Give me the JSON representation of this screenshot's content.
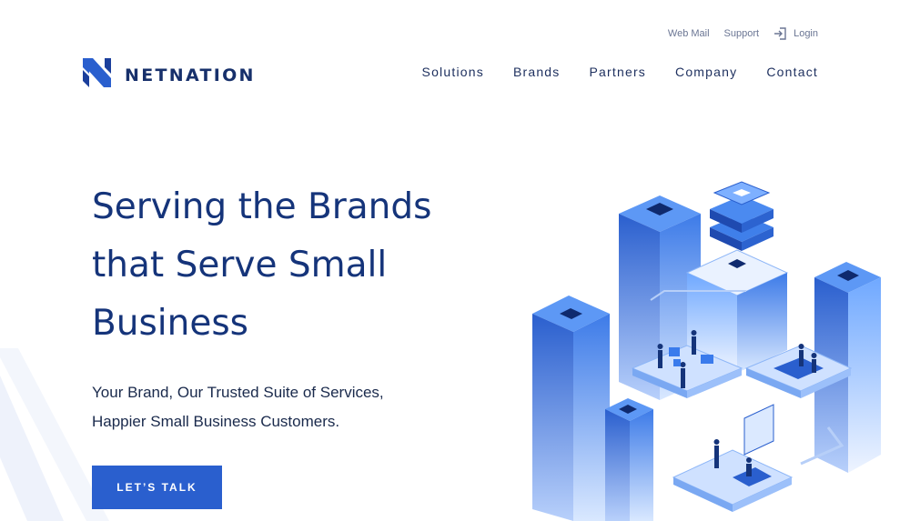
{
  "brand": {
    "name": "NETNATION",
    "accent": "#2a5fce",
    "text_color": "#15347a"
  },
  "utility_nav": {
    "webmail": "Web Mail",
    "support": "Support",
    "login": "Login",
    "login_icon": "sign-in-icon"
  },
  "nav": {
    "items": [
      "Solutions",
      "Brands",
      "Partners",
      "Company",
      "Contact"
    ]
  },
  "hero": {
    "title_lines": [
      "Serving the Brands",
      "that Serve Small",
      "Business"
    ],
    "subtitle_lines": [
      "Your Brand, Our Trusted Suite of Services,",
      "Happier Small Business Customers."
    ],
    "cta": "LET’S TALK"
  },
  "illustration": {
    "icon": "isometric-data-center-illustration"
  }
}
